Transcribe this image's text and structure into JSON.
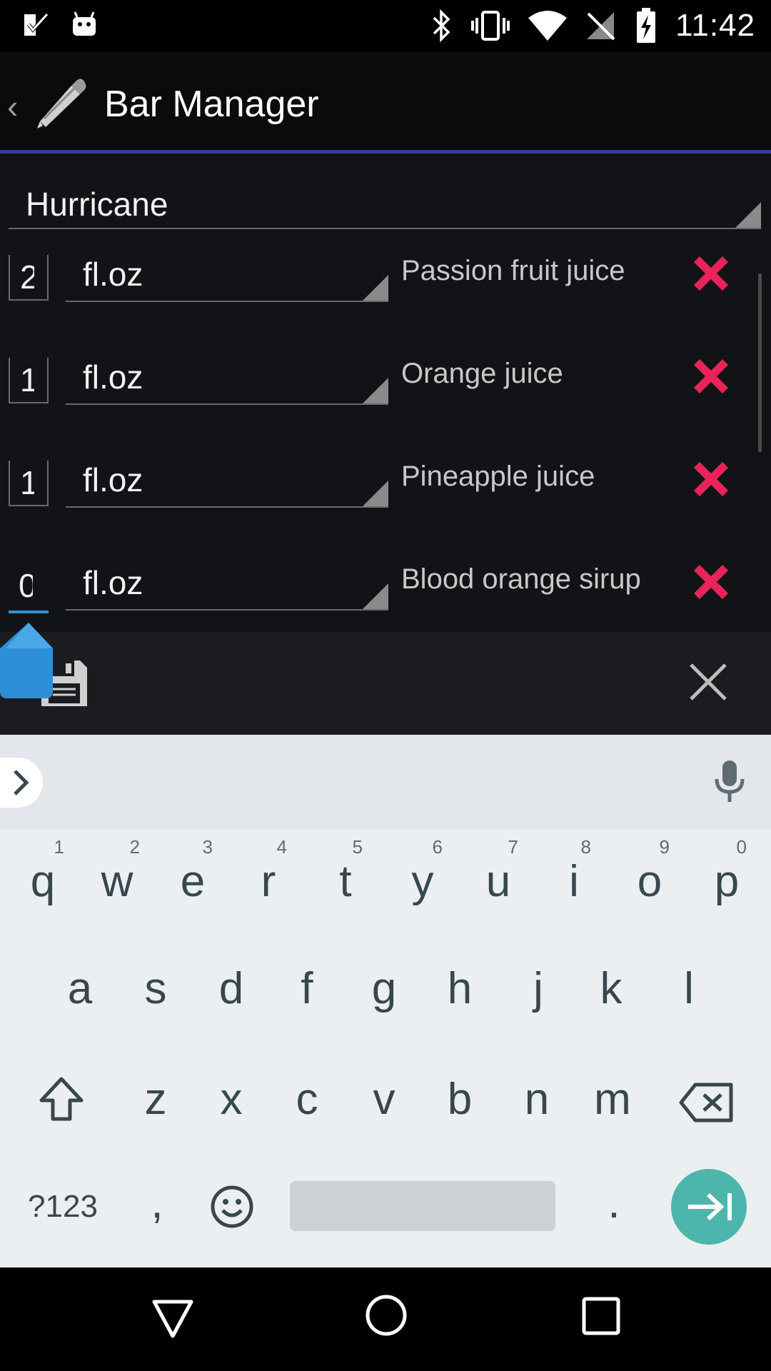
{
  "status_bar": {
    "time": "11:42",
    "icons": [
      "task-check-icon",
      "android-icon",
      "bluetooth-icon",
      "vibrate-icon",
      "wifi-icon",
      "no-signal-icon",
      "battery-charging-icon"
    ]
  },
  "action_bar": {
    "back_glyph": "‹",
    "title": "Bar Manager",
    "icon": "pencil-icon",
    "accent_color": "#3a3a9a"
  },
  "form": {
    "cocktail_name": "Hurricane",
    "ingredients": [
      {
        "qty": "2",
        "unit": "fl.oz",
        "name": "Passion fruit juice"
      },
      {
        "qty": "1",
        "unit": "fl.oz",
        "name": "Orange juice"
      },
      {
        "qty": "1",
        "unit": "fl.oz",
        "name": "Pineapple juice"
      },
      {
        "qty": "0",
        "unit": "fl.oz",
        "name": "Blood orange sirup"
      }
    ],
    "delete_color": "#e8245a"
  },
  "actions": {
    "save_icon": "floppy-disk-icon",
    "close_icon": "close-icon"
  },
  "keyboard": {
    "row1": [
      {
        "key": "q",
        "hint": "1"
      },
      {
        "key": "w",
        "hint": "2"
      },
      {
        "key": "e",
        "hint": "3"
      },
      {
        "key": "r",
        "hint": "4"
      },
      {
        "key": "t",
        "hint": "5"
      },
      {
        "key": "y",
        "hint": "6"
      },
      {
        "key": "u",
        "hint": "7"
      },
      {
        "key": "i",
        "hint": "8"
      },
      {
        "key": "o",
        "hint": "9"
      },
      {
        "key": "p",
        "hint": "0"
      }
    ],
    "row2": [
      "a",
      "s",
      "d",
      "f",
      "g",
      "h",
      "j",
      "k",
      "l"
    ],
    "row3": [
      "z",
      "x",
      "c",
      "v",
      "b",
      "n",
      "m"
    ],
    "symbols_label": "?123",
    "comma": ",",
    "period": ".",
    "enter_color": "#4db6ac"
  },
  "nav_bar": {
    "icons": [
      "back-triangle-icon",
      "home-circle-icon",
      "recents-square-icon"
    ]
  }
}
